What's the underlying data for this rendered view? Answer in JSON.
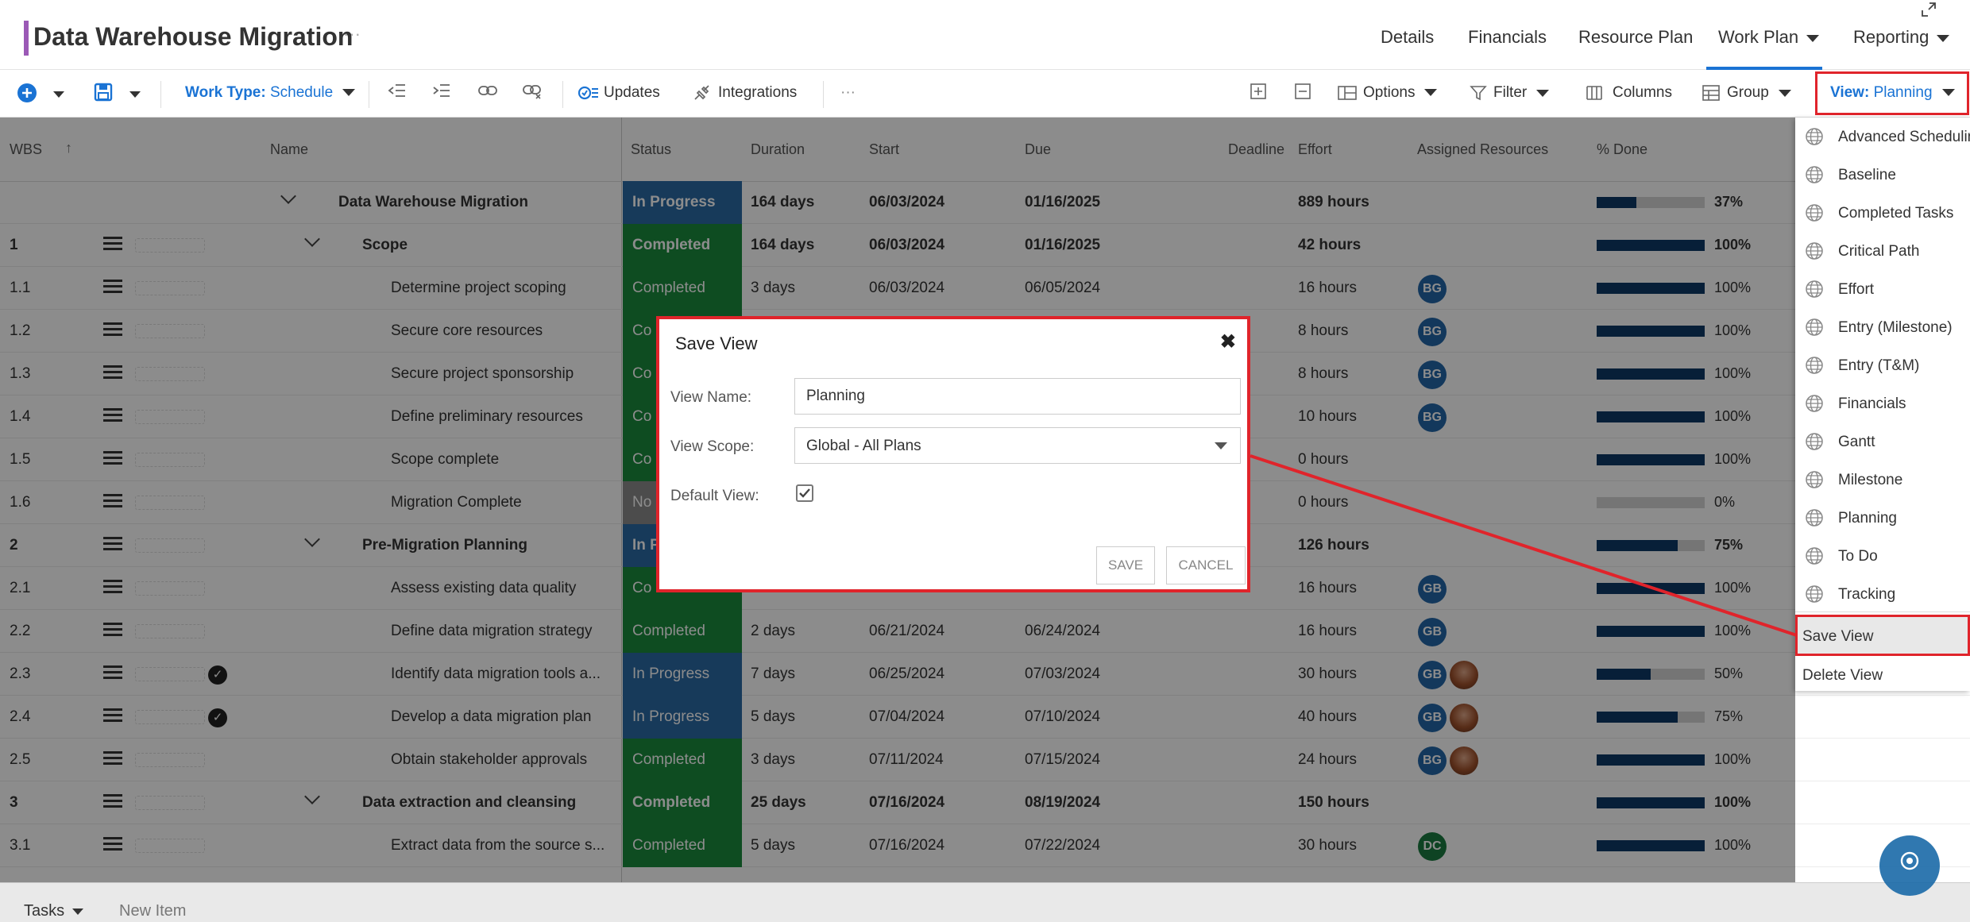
{
  "header": {
    "title": "Data Warehouse Migration",
    "title_dots": "···",
    "nav": [
      {
        "label": "Details"
      },
      {
        "label": "Financials"
      },
      {
        "label": "Resource Plan"
      },
      {
        "label": "Work Plan"
      },
      {
        "label": "Reporting"
      }
    ]
  },
  "toolbar": {
    "work_type_label": "Work Type:",
    "work_type_value": "Schedule",
    "updates": "Updates",
    "integrations": "Integrations",
    "more": "···",
    "options": "Options",
    "filter": "Filter",
    "columns": "Columns",
    "group": "Group",
    "view_label": "View:",
    "view_value": "Planning"
  },
  "grid": {
    "columns": [
      "WBS",
      "Name",
      "Status",
      "Duration",
      "Start",
      "Due",
      "Deadline",
      "Effort",
      "Assigned Resources",
      "% Done"
    ],
    "rows": [
      {
        "wbs": "",
        "name": "Data Warehouse Migration",
        "status": "In Progress",
        "duration": "164 days",
        "start": "06/03/2024",
        "due": "01/16/2025",
        "effort": "889 hours",
        "pct": "37%",
        "pct_value": 0.37,
        "resources": []
      },
      {
        "wbs": "1",
        "name": "Scope",
        "status": "Completed",
        "duration": "164 days",
        "start": "06/03/2024",
        "due": "01/16/2025",
        "effort": "42 hours",
        "pct": "100%",
        "pct_value": 1.0,
        "resources": []
      },
      {
        "wbs": "1.1",
        "name": "Determine project scoping",
        "status": "Completed",
        "duration": "3 days",
        "start": "06/03/2024",
        "due": "06/05/2024",
        "effort": "16 hours",
        "pct": "100%",
        "pct_value": 1.0,
        "resources": [
          "BG"
        ]
      },
      {
        "wbs": "1.2",
        "name": "Secure core resources",
        "status": "Co",
        "duration": "",
        "start": "",
        "due": "",
        "effort": "8 hours",
        "pct": "100%",
        "pct_value": 1.0,
        "resources": [
          "BG"
        ]
      },
      {
        "wbs": "1.3",
        "name": "Secure project sponsorship",
        "status": "Co",
        "duration": "",
        "start": "",
        "due": "",
        "effort": "8 hours",
        "pct": "100%",
        "pct_value": 1.0,
        "resources": [
          "BG"
        ]
      },
      {
        "wbs": "1.4",
        "name": "Define preliminary resources",
        "status": "Co",
        "duration": "",
        "start": "",
        "due": "",
        "effort": "10 hours",
        "pct": "100%",
        "pct_value": 1.0,
        "resources": [
          "BG"
        ]
      },
      {
        "wbs": "1.5",
        "name": "Scope complete",
        "status": "Co",
        "duration": "",
        "start": "",
        "due": "",
        "effort": "0 hours",
        "pct": "100%",
        "pct_value": 1.0,
        "resources": []
      },
      {
        "wbs": "1.6",
        "name": "Migration Complete",
        "status": "No",
        "duration": "",
        "start": "",
        "due": "",
        "effort": "0 hours",
        "pct": "0%",
        "pct_value": 0.0,
        "resources": []
      },
      {
        "wbs": "2",
        "name": "Pre-Migration Planning",
        "status": "In P",
        "duration": "",
        "start": "",
        "due": "",
        "effort": "126 hours",
        "pct": "75%",
        "pct_value": 0.75,
        "resources": []
      },
      {
        "wbs": "2.1",
        "name": "Assess existing data quality",
        "status": "Co",
        "duration": "",
        "start": "",
        "due": "",
        "effort": "16 hours",
        "pct": "100%",
        "pct_value": 1.0,
        "resources": [
          "GB"
        ]
      },
      {
        "wbs": "2.2",
        "name": "Define data migration strategy",
        "status": "Completed",
        "duration": "2 days",
        "start": "06/21/2024",
        "due": "06/24/2024",
        "effort": "16 hours",
        "pct": "100%",
        "pct_value": 1.0,
        "resources": [
          "GB"
        ]
      },
      {
        "wbs": "2.3",
        "name": "Identify data migration tools a...",
        "status": "In Progress",
        "duration": "7 days",
        "start": "06/25/2024",
        "due": "07/03/2024",
        "effort": "30 hours",
        "pct": "50%",
        "pct_value": 0.5,
        "resources": [
          "GB",
          "photo"
        ]
      },
      {
        "wbs": "2.4",
        "name": "Develop a data migration plan",
        "status": "In Progress",
        "duration": "5 days",
        "start": "07/04/2024",
        "due": "07/10/2024",
        "effort": "40 hours",
        "pct": "75%",
        "pct_value": 0.75,
        "resources": [
          "GB",
          "photo"
        ]
      },
      {
        "wbs": "2.5",
        "name": "Obtain stakeholder approvals",
        "status": "Completed",
        "duration": "3 days",
        "start": "07/11/2024",
        "due": "07/15/2024",
        "effort": "24 hours",
        "pct": "100%",
        "pct_value": 1.0,
        "resources": [
          "BG",
          "photo"
        ]
      },
      {
        "wbs": "3",
        "name": "Data extraction and cleansing",
        "status": "Completed",
        "duration": "25 days",
        "start": "07/16/2024",
        "due": "08/19/2024",
        "effort": "150 hours",
        "pct": "100%",
        "pct_value": 1.0,
        "resources": []
      },
      {
        "wbs": "3.1",
        "name": "Extract data from the source s...",
        "status": "Completed",
        "duration": "5 days",
        "start": "07/16/2024",
        "due": "07/22/2024",
        "effort": "30 hours",
        "pct": "100%",
        "pct_value": 1.0,
        "resources": [
          "DC"
        ]
      }
    ]
  },
  "view_menu": {
    "items": [
      "Advanced Scheduling",
      "Baseline",
      "Completed Tasks",
      "Critical Path",
      "Effort",
      "Entry (Milestone)",
      "Entry (T&M)",
      "Financials",
      "Gantt",
      "Milestone",
      "Planning",
      "To Do",
      "Tracking"
    ],
    "save_view": "Save View",
    "delete_view": "Delete View"
  },
  "dialog": {
    "title": "Save View",
    "close": "✖",
    "view_name_label": "View Name:",
    "view_name_value": "Planning",
    "view_scope_label": "View Scope:",
    "view_scope_value": "Global - All Plans",
    "default_view_label": "Default View:",
    "default_view_checked": true,
    "save_button": "SAVE",
    "cancel_button": "CANCEL"
  },
  "footer": {
    "tasks_tab": "Tasks",
    "new_item": "New Item"
  },
  "colors": {
    "accent": "#1a73d4",
    "completed": "#1a8b3c",
    "in_progress": "#2b6aa5",
    "highlight": "#e0242b",
    "title_accent": "#9b59b6"
  }
}
